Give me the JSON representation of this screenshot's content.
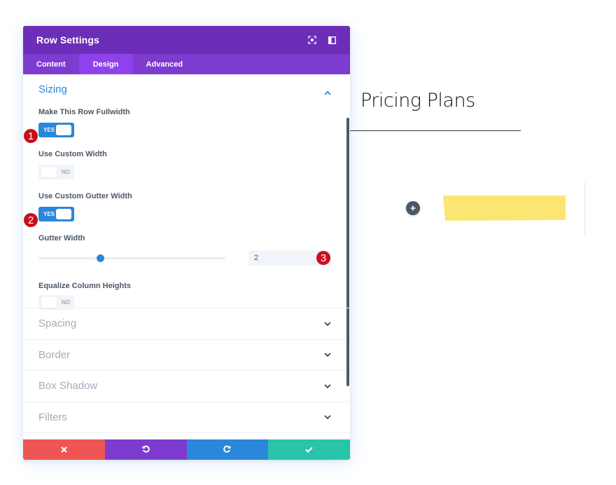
{
  "modal": {
    "title": "Row Settings",
    "header_icons": [
      "fullscreen-icon",
      "sidebar-layout-icon"
    ],
    "tabs": [
      {
        "label": "Content",
        "active": false
      },
      {
        "label": "Design",
        "active": true
      },
      {
        "label": "Advanced",
        "active": false
      }
    ],
    "sizing": {
      "title": "Sizing",
      "expanded": true,
      "fields": {
        "fullwidth": {
          "label": "Make This Row Fullwidth",
          "value": "YES",
          "on": true,
          "badge": "1"
        },
        "custom_width": {
          "label": "Use Custom Width",
          "value": "NO",
          "on": false
        },
        "custom_gutter": {
          "label": "Use Custom Gutter Width",
          "value": "YES",
          "on": true,
          "badge": "2"
        },
        "gutter_width": {
          "label": "Gutter Width",
          "value": "2",
          "slider_fraction": 0.33,
          "badge": "3"
        },
        "equalize": {
          "label": "Equalize Column Heights",
          "value": "NO",
          "on": false
        }
      }
    },
    "collapsed_sections": [
      {
        "title": "Spacing"
      },
      {
        "title": "Border"
      },
      {
        "title": "Box Shadow"
      },
      {
        "title": "Filters"
      }
    ],
    "footer": {
      "cancel": {
        "icon": "close-icon",
        "color": "#ef5555"
      },
      "undo": {
        "icon": "undo-icon",
        "color": "#7e3bd0"
      },
      "redo": {
        "icon": "redo-icon",
        "color": "#2b87da"
      },
      "save": {
        "icon": "check-icon",
        "color": "#29c4a9"
      }
    }
  },
  "canvas": {
    "heading": "Pricing Plans",
    "add_button": "+",
    "accent_yellow": "#fbe673"
  },
  "colors": {
    "header": "#6c2eb9",
    "tabs": "#7e3bd0",
    "tab_active": "#8f42ec",
    "accent": "#2b87da",
    "badge": "#c8101c"
  }
}
